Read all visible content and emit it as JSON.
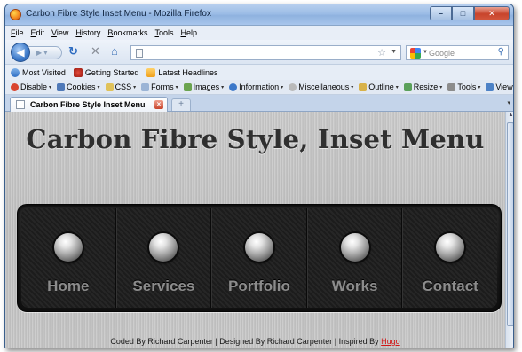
{
  "window": {
    "title": "Carbon Fibre Style Inset Menu - Mozilla Firefox"
  },
  "menubar": [
    "File",
    "Edit",
    "View",
    "History",
    "Bookmarks",
    "Tools",
    "Help"
  ],
  "navbar": {
    "search_placeholder": "Google"
  },
  "bookmarks": [
    "Most Visited",
    "Getting Started",
    "Latest Headlines"
  ],
  "devbar": [
    "Disable",
    "Cookies",
    "CSS",
    "Forms",
    "Images",
    "Information",
    "Miscellaneous",
    "Outline",
    "Resize",
    "Tools",
    "View Source"
  ],
  "tab": {
    "title": "Carbon Fibre Style Inset Menu"
  },
  "page": {
    "title": "Carbon Fibre Style, Inset Menu",
    "menu": [
      "Home",
      "Services",
      "Portfolio",
      "Works",
      "Contact"
    ],
    "footer": {
      "text": "Coded By Richard Carpenter | Designed By Richard Carpenter | Inspired By ",
      "link": "Hugo"
    }
  },
  "colors": {
    "link": "#d11616",
    "title": "#2f2f2f",
    "menu_label": "#8c8c8c"
  }
}
